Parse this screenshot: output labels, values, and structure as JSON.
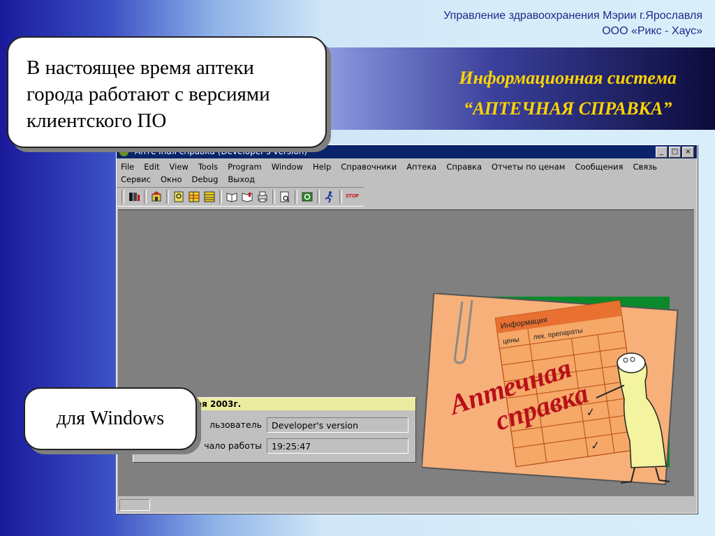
{
  "header": {
    "org_line1": "Управление здравоохранения Мэрии г.Ярославля",
    "org_line2": "ООО «Рикс - Хаус»"
  },
  "banner": {
    "line1": "Информационная система",
    "line2": "“АПТЕЧНАЯ СПРАВКА”"
  },
  "callouts": {
    "top": [
      "В настоящее время аптеки",
      "города работают с версиями",
      "клиентского ПО"
    ],
    "bottom": "для Windows"
  },
  "app": {
    "title": "Аптечная справка (Developer's version)",
    "window_buttons": [
      "_",
      "□",
      "×"
    ],
    "menu_row1": [
      "File",
      "Edit",
      "View",
      "Tools",
      "Program",
      "Window",
      "Help",
      "Справочники",
      "Аптека",
      "Справка",
      "Отчеты по ценам",
      "Сообщения",
      "Связь"
    ],
    "menu_row2": [
      "Сервис",
      "Окно",
      "Debug",
      "Выход"
    ],
    "toolbar_stop": "STOP",
    "info_panel": {
      "heading": "ая 2003г.",
      "user_label": "льзователь",
      "user_value": "Developer's version",
      "start_label": "чало работы",
      "start_value": "19:25:47"
    }
  },
  "logo": {
    "card_title": "Информация",
    "col1": "цены",
    "col2": "лек. препараты",
    "script_line1": "Аптечная",
    "script_line2": "справка"
  },
  "colors": {
    "banner_text": "#ffd400",
    "titlebar": "#0a246a",
    "logo_card": "#f7b07a",
    "logo_text": "#b8101a"
  }
}
